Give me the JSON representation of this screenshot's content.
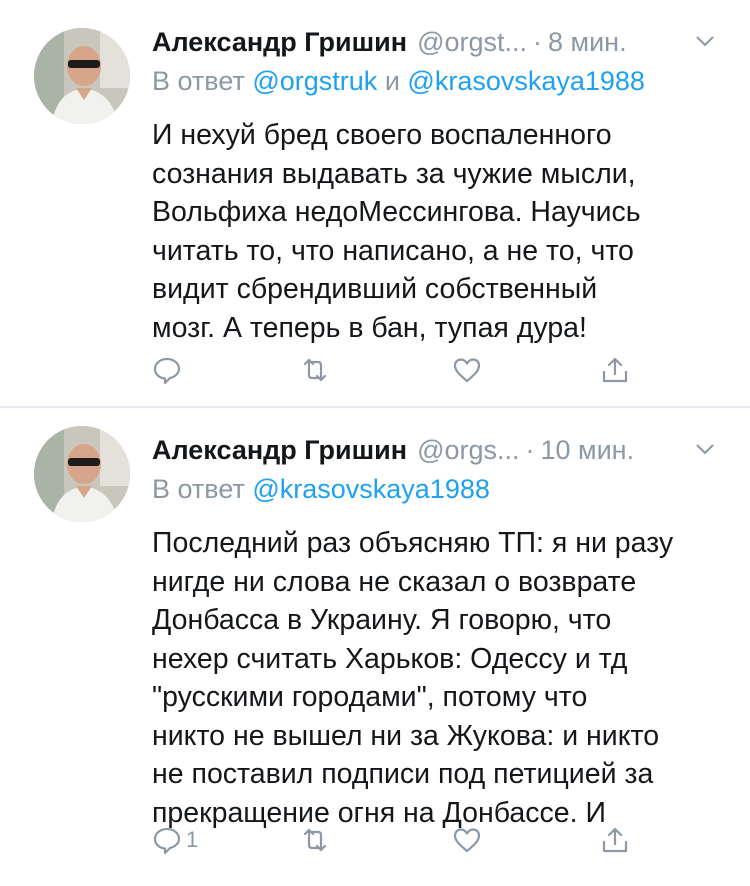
{
  "tweets": [
    {
      "author_name": "Александр Гришин",
      "handle": "@orgst...",
      "separator": "·",
      "time": "8 мин.",
      "reply_prefix": "В ответ",
      "reply_to_1": "@orgstruk",
      "reply_conj": "и",
      "reply_to_2": "@krasovskaya1988",
      "lines": [
        "И нехуй бред своего воспаленного",
        "сознания выдавать за чужие мысли,",
        "Вольфиха недоМессингова. Научись",
        "читать то, что написано, а не то, что",
        "видит сбрендивший собственный",
        "мозг. А теперь в бан, тупая дура!"
      ],
      "reply_count": ""
    },
    {
      "author_name": "Александр Гришин",
      "handle": "@orgs...",
      "separator": "·",
      "time": "10 мин.",
      "reply_prefix": "В ответ",
      "reply_to_1": "@krasovskaya1988",
      "lines": [
        "Последний раз объясняю ТП: я ни разу",
        "нигде ни слова не сказал о возврате",
        "Донбасса в Украину. Я говорю, что",
        "нехер считать Харьков: Одессу и тд",
        "\"русскими городами\", потому что",
        "никто не вышел ни за Жукова: и никто",
        "не поставил подписи под петицией за",
        "прекращение огня на Донбассе. И"
      ],
      "reply_count": "1"
    }
  ],
  "icons": {
    "reply": "reply-icon",
    "retweet": "retweet-icon",
    "like": "like-icon",
    "share": "share-icon",
    "menu": "chevron-down-icon",
    "avatar": "avatar"
  },
  "colors": {
    "link": "#1da1f2",
    "secondary_text": "#8c98a4",
    "primary_text": "#14171a",
    "divider": "#e6ecf0"
  }
}
